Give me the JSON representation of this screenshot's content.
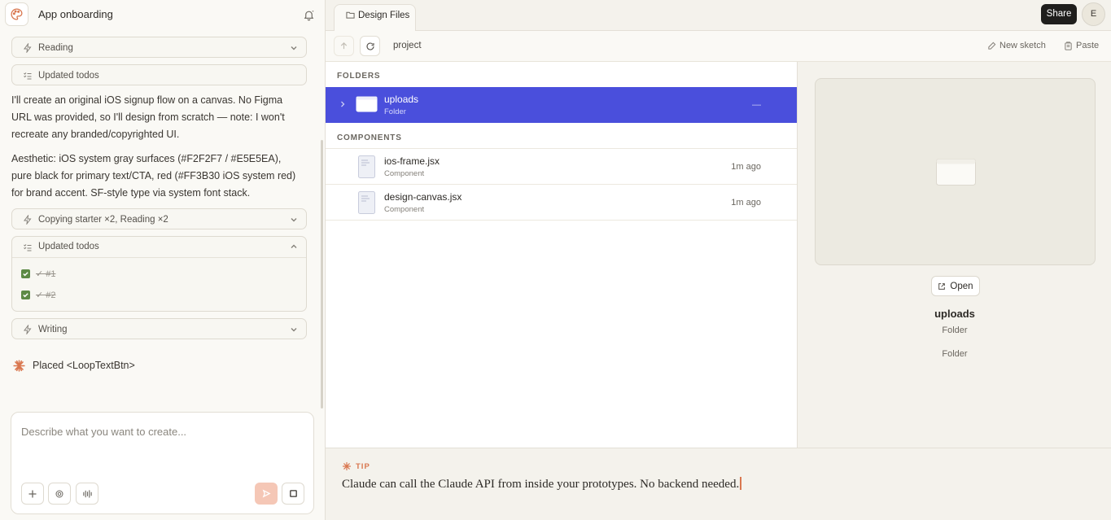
{
  "left_panel": {
    "title": "App onboarding",
    "chat": {
      "tool_reading": "Reading",
      "tool_updated_todos_1": "Updated todos",
      "message_1": "I'll create an original iOS signup flow on a canvas. No Figma URL was provided, so I'll design from scratch — note: I won't recreate any branded/copyrighted UI.",
      "message_2": "Aesthetic: iOS system gray surfaces (#F2F2F7 / #E5E5EA), pure black for primary text/CTA, red (#FF3B30 iOS system red) for brand accent. SF-style type via system font stack.",
      "tool_copying": "Copying starter ×2, Reading ×2",
      "tool_updated_todos_2": "Updated todos",
      "todos": [
        "✓ #1",
        "✓ #2"
      ],
      "tool_writing": "Writing",
      "placed": "Placed <LoopTextBtn>"
    },
    "composer": {
      "placeholder": "Describe what you want to create..."
    }
  },
  "topbar": {
    "tab_label": "Design Files",
    "share_label": "Share",
    "avatar_initial": "E"
  },
  "toolbar": {
    "breadcrumb": "project",
    "new_sketch": "New sketch",
    "paste": "Paste"
  },
  "file_list": {
    "folders_header": "FOLDERS",
    "components_header": "COMPONENTS",
    "folders": [
      {
        "name": "uploads",
        "type": "Folder",
        "time": "—"
      }
    ],
    "components": [
      {
        "name": "ios-frame.jsx",
        "type": "Component",
        "time": "1m ago"
      },
      {
        "name": "design-canvas.jsx",
        "type": "Component",
        "time": "1m ago"
      }
    ]
  },
  "preview": {
    "open_label": "Open",
    "name": "uploads",
    "kind": "Folder",
    "kind_detail": "Folder"
  },
  "tip": {
    "label": "TIP",
    "text": "Claude can call the Claude API from inside your prototypes. No backend needed."
  },
  "colors": {
    "accent": "#D9774F",
    "selection": "#4A4FDC",
    "todo_check": "#5D8A45",
    "send_disabled": "#F5C7B6"
  }
}
